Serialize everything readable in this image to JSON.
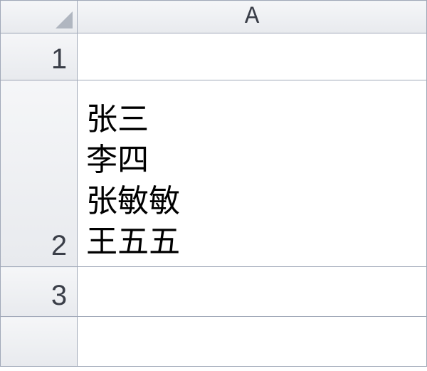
{
  "columns": [
    "A"
  ],
  "rows": [
    {
      "num": "1",
      "value": ""
    },
    {
      "num": "2",
      "value": "张三\n李四\n张敏敏\n王五五"
    },
    {
      "num": "3",
      "value": ""
    },
    {
      "num": "",
      "value": ""
    }
  ]
}
